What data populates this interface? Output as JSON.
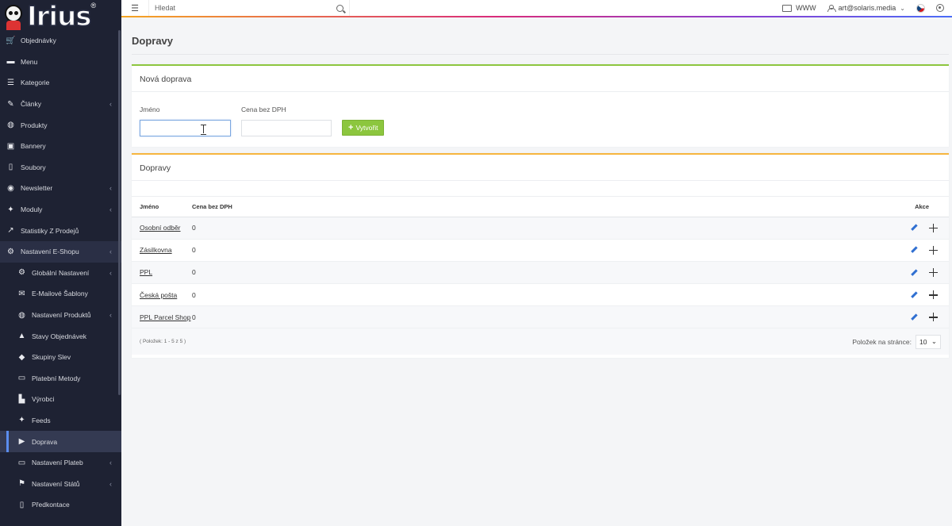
{
  "brand": {
    "logo_text": "Irius"
  },
  "topbar": {
    "search_placeholder": "Hledat",
    "www_label": "WWW",
    "user_email": "art@solaris.media"
  },
  "sidebar": {
    "items": [
      {
        "label": "Objednávky",
        "icon": "cart-icon"
      },
      {
        "label": "Menu",
        "icon": "folder-icon"
      },
      {
        "label": "Kategorie",
        "icon": "list-icon"
      },
      {
        "label": "Články",
        "icon": "pencil-icon",
        "caret": true
      },
      {
        "label": "Produkty",
        "icon": "globe-icon"
      },
      {
        "label": "Bannery",
        "icon": "image-icon"
      },
      {
        "label": "Soubory",
        "icon": "file-icon"
      },
      {
        "label": "Newsletter",
        "icon": "newsletter-icon",
        "caret": true
      },
      {
        "label": "Moduly",
        "icon": "puzzle-icon",
        "caret": true
      },
      {
        "label": "Statistiky Z Prodejů",
        "icon": "chart-icon"
      },
      {
        "label": "Nastavení E-Shopu",
        "icon": "cogs-icon",
        "caret": true
      }
    ],
    "sub_items": [
      {
        "label": "Globální Nastavení",
        "icon": "gear-icon",
        "caret": true
      },
      {
        "label": "E-Mailové Šablony",
        "icon": "envelope-icon"
      },
      {
        "label": "Nastavení Produktů",
        "icon": "globe-icon",
        "caret": true
      },
      {
        "label": "Stavy Objednávek",
        "icon": "bell-icon"
      },
      {
        "label": "Skupiny Slev",
        "icon": "tag-icon"
      },
      {
        "label": "Platební Metody",
        "icon": "credit-card-icon"
      },
      {
        "label": "Výrobci",
        "icon": "factory-icon"
      },
      {
        "label": "Feeds",
        "icon": "puzzle-icon"
      },
      {
        "label": "Doprava",
        "icon": "truck-icon"
      },
      {
        "label": "Nastavení Plateb",
        "icon": "credit-card-icon",
        "caret": true
      },
      {
        "label": "Nastavení Států",
        "icon": "flag-icon",
        "caret": true
      },
      {
        "label": "Předkontace",
        "icon": "file-icon"
      }
    ]
  },
  "page": {
    "title": "Dopravy"
  },
  "new_form": {
    "header": "Nová doprava",
    "name_label": "Jméno",
    "name_value": "",
    "price_label": "Cena bez DPH",
    "price_value": "",
    "create_label": "Vytvořit"
  },
  "list": {
    "header": "Dopravy",
    "columns": {
      "name": "Jméno",
      "price": "Cena bez DPH",
      "actions": "Akce"
    },
    "rows": [
      {
        "name": "Osobní odběr",
        "price": "0"
      },
      {
        "name": "Zásilkovna",
        "price": "0"
      },
      {
        "name": "PPL",
        "price": "0"
      },
      {
        "name": "Česká pošta",
        "price": "0"
      },
      {
        "name": "PPL Parcel Shop",
        "price": "0"
      }
    ],
    "count_text": "( Položek: 1 - 5 z 5 )",
    "per_page_label": "Položek na stránce:",
    "per_page_value": "10"
  }
}
